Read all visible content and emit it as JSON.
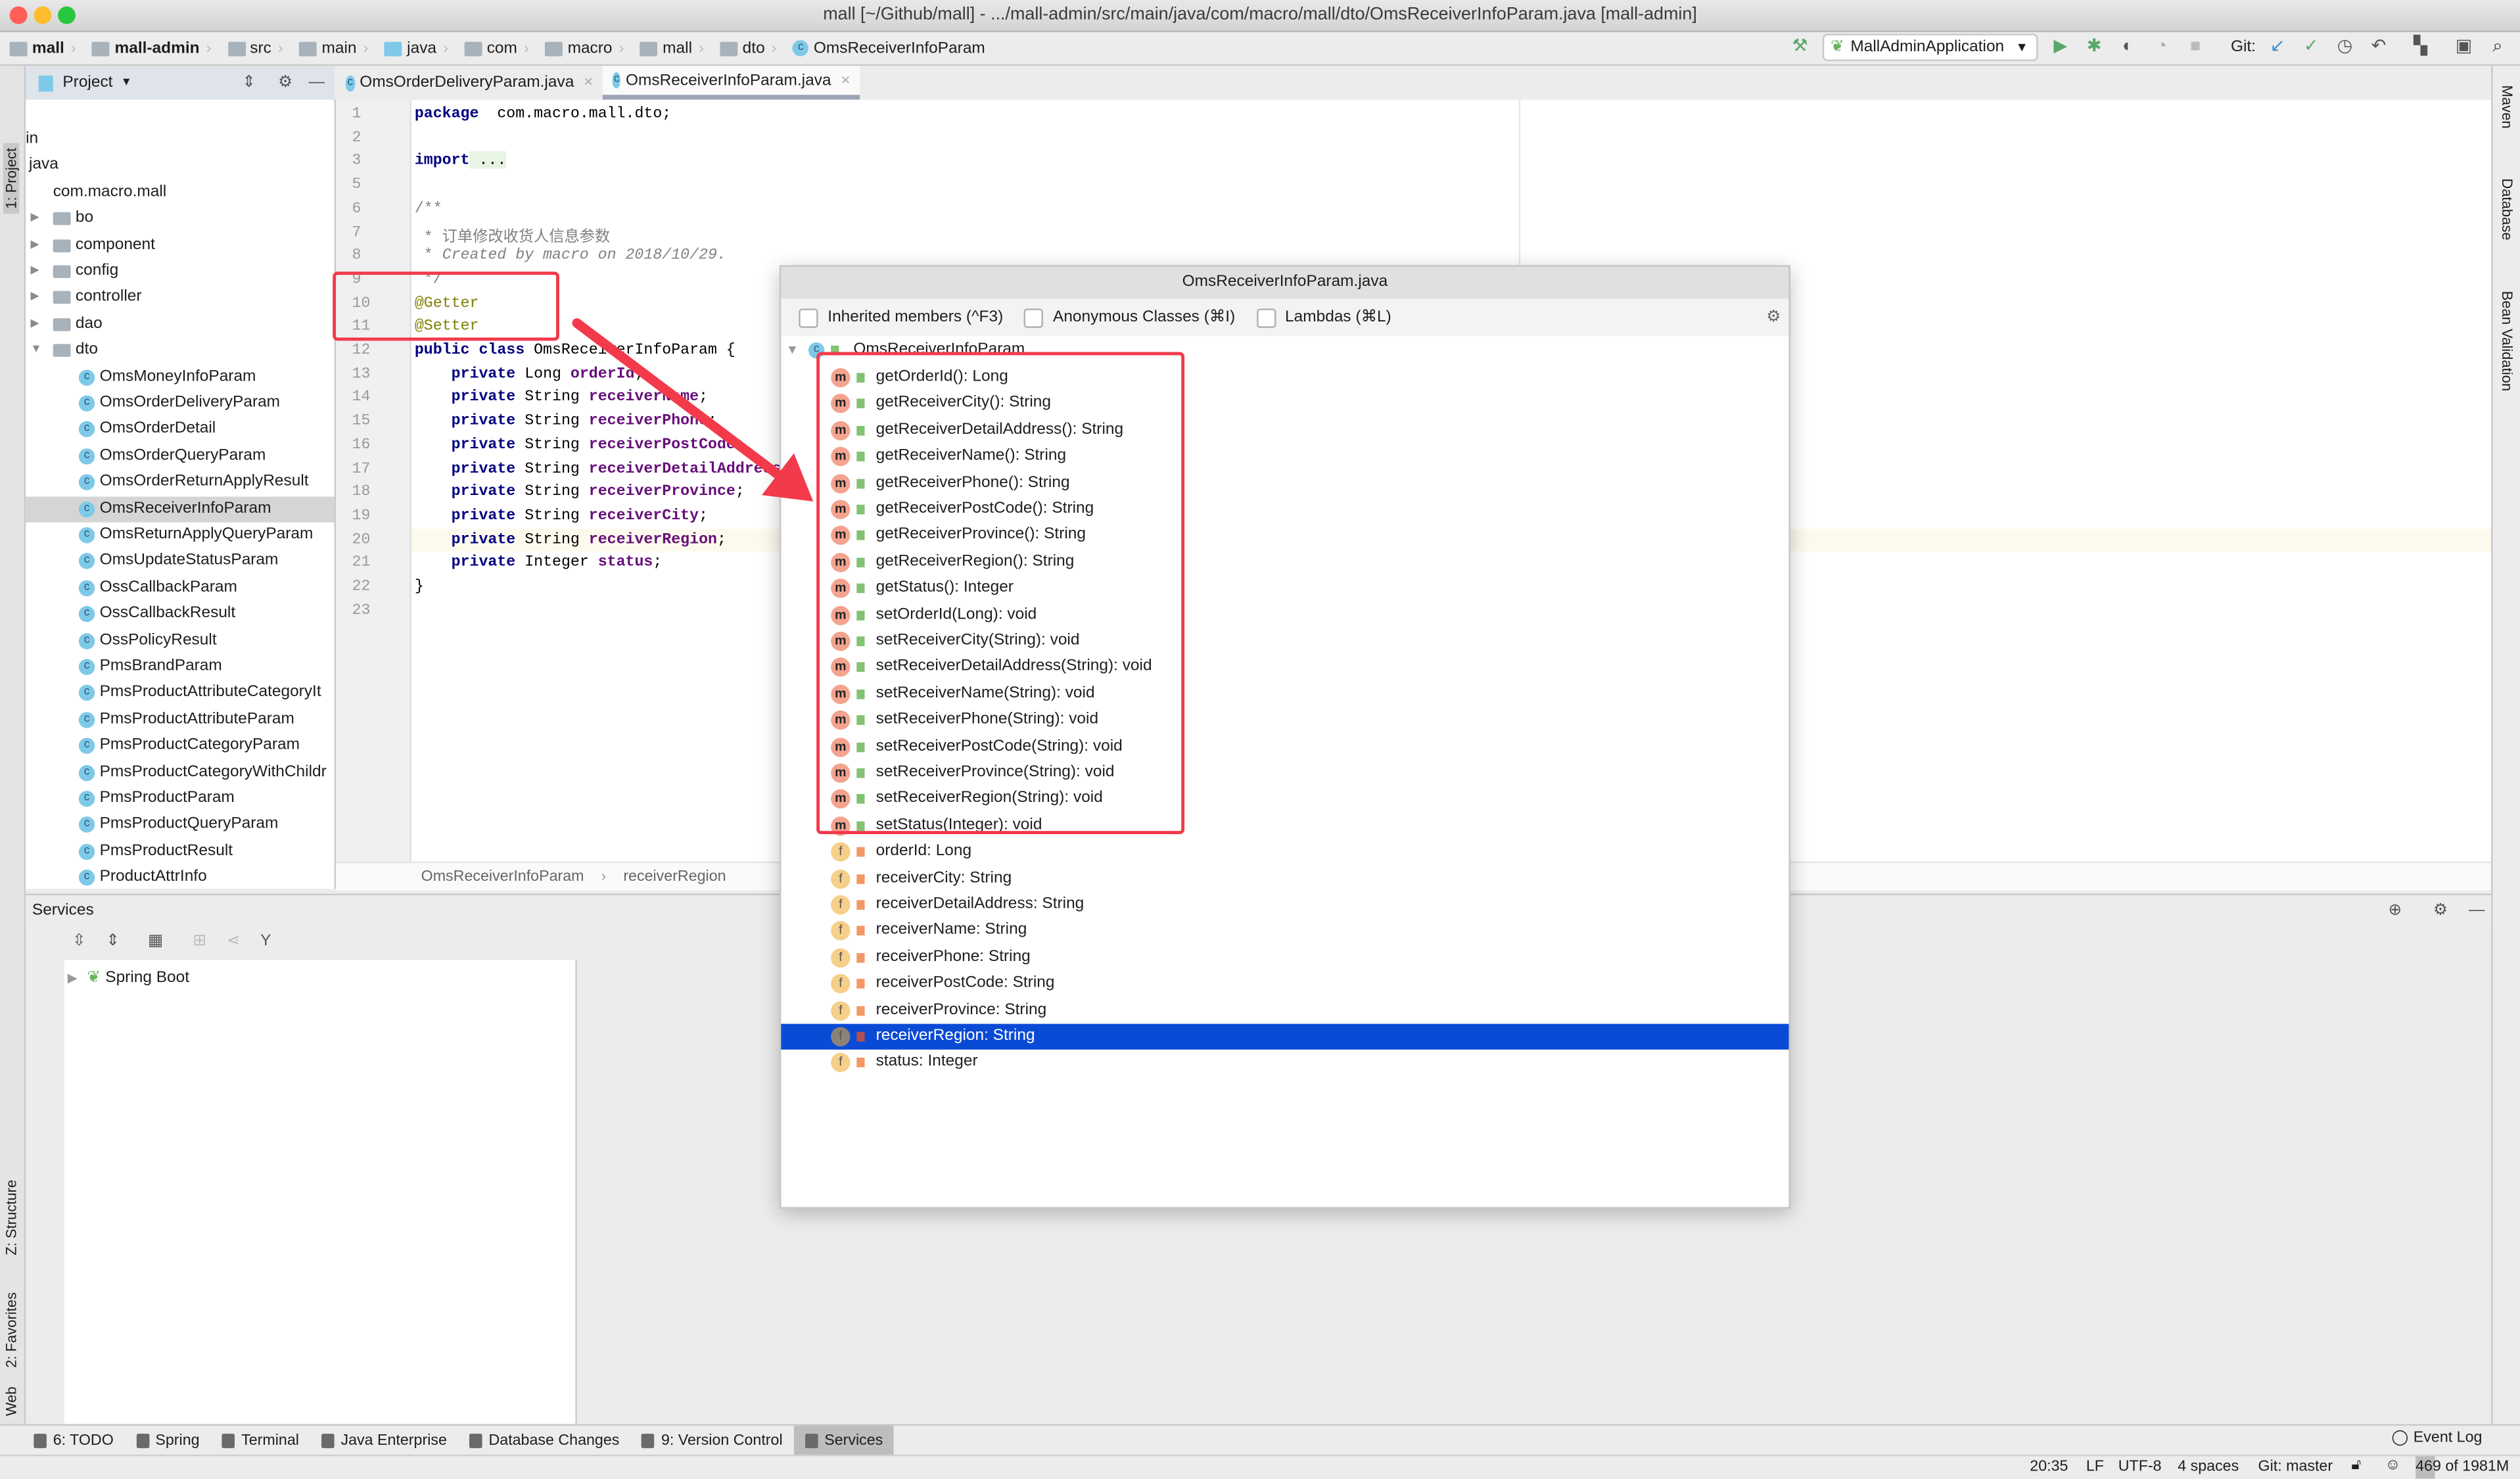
{
  "window": {
    "title": "mall [~/Github/mall] - .../mall-admin/src/main/java/com/macro/mall/dto/OmsReceiverInfoParam.java [mall-admin]"
  },
  "navbar": {
    "crumbs": [
      "mall",
      "mall-admin",
      "src",
      "main",
      "java",
      "com",
      "macro",
      "mall",
      "dto",
      "OmsReceiverInfoParam"
    ],
    "run_config": "MallAdminApplication",
    "git_label": "Git:"
  },
  "left_strip": {
    "project": "1: Project",
    "structure": "Z: Structure",
    "favorites": "2: Favorites",
    "web": "Web"
  },
  "right_strip": {
    "maven": "Maven",
    "database": "Database",
    "bean_validation": "Bean Validation"
  },
  "project_panel": {
    "title": "Project",
    "tree": [
      {
        "label": "in",
        "level": 0
      },
      {
        "label": "java",
        "level": 0
      },
      {
        "label": "com.macro.mall",
        "level": 1
      },
      {
        "label": "bo",
        "level": 2,
        "folder": true
      },
      {
        "label": "component",
        "level": 2,
        "folder": true
      },
      {
        "label": "config",
        "level": 2,
        "folder": true
      },
      {
        "label": "controller",
        "level": 2,
        "folder": true
      },
      {
        "label": "dao",
        "level": 2,
        "folder": true
      },
      {
        "label": "dto",
        "level": 2,
        "folder": true,
        "open": true
      },
      {
        "label": "OmsMoneyInfoParam",
        "level": 3
      },
      {
        "label": "OmsOrderDeliveryParam",
        "level": 3
      },
      {
        "label": "OmsOrderDetail",
        "level": 3
      },
      {
        "label": "OmsOrderQueryParam",
        "level": 3
      },
      {
        "label": "OmsOrderReturnApplyResult",
        "level": 3
      },
      {
        "label": "OmsReceiverInfoParam",
        "level": 3,
        "selected": true
      },
      {
        "label": "OmsReturnApplyQueryParam",
        "level": 3
      },
      {
        "label": "OmsUpdateStatusParam",
        "level": 3
      },
      {
        "label": "OssCallbackParam",
        "level": 3
      },
      {
        "label": "OssCallbackResult",
        "level": 3
      },
      {
        "label": "OssPolicyResult",
        "level": 3
      },
      {
        "label": "PmsBrandParam",
        "level": 3
      },
      {
        "label": "PmsProductAttributeCategoryIt",
        "level": 3
      },
      {
        "label": "PmsProductAttributeParam",
        "level": 3
      },
      {
        "label": "PmsProductCategoryParam",
        "level": 3
      },
      {
        "label": "PmsProductCategoryWithChildr",
        "level": 3
      },
      {
        "label": "PmsProductParam",
        "level": 3
      },
      {
        "label": "PmsProductQueryParam",
        "level": 3
      },
      {
        "label": "PmsProductResult",
        "level": 3
      },
      {
        "label": "ProductAttrInfo",
        "level": 3
      }
    ]
  },
  "editor": {
    "tabs": [
      {
        "label": "OmsOrderDeliveryParam.java",
        "active": false
      },
      {
        "label": "OmsReceiverInfoParam.java",
        "active": true
      }
    ],
    "current_line": "20",
    "lines": [
      {
        "n": "1",
        "html": [
          [
            "kw",
            "package"
          ],
          [
            "",
            "  com.macro.mall.dto;"
          ]
        ]
      },
      {
        "n": "2",
        "html": []
      },
      {
        "n": "3",
        "html": [
          [
            "kw",
            "import"
          ],
          [
            "",
            " ..."
          ]
        ]
      },
      {
        "n": "5",
        "html": []
      },
      {
        "n": "6",
        "html": [
          [
            "cmt",
            "/**"
          ]
        ]
      },
      {
        "n": "7",
        "html": [
          [
            "cmt",
            " * 订单修改收货人信息参数"
          ]
        ]
      },
      {
        "n": "8",
        "html": [
          [
            "cmt",
            " * "
          ],
          [
            "cmti",
            "Created by macro on 2018/10/29."
          ]
        ]
      },
      {
        "n": "9",
        "html": [
          [
            "cmt",
            " */"
          ]
        ]
      },
      {
        "n": "10",
        "html": [
          [
            "ann",
            "@Getter"
          ]
        ]
      },
      {
        "n": "11",
        "html": [
          [
            "ann",
            "@Setter"
          ]
        ]
      },
      {
        "n": "12",
        "html": [
          [
            "kw",
            "public class"
          ],
          [
            "",
            " OmsReceiverInfoParam {"
          ]
        ]
      },
      {
        "n": "13",
        "html": [
          [
            "",
            "    "
          ],
          [
            "kw",
            "private"
          ],
          [
            "",
            " Long "
          ],
          [
            "fld",
            "orderId"
          ],
          [
            "",
            ";"
          ]
        ]
      },
      {
        "n": "14",
        "html": [
          [
            "",
            "    "
          ],
          [
            "kw",
            "private"
          ],
          [
            "",
            " String "
          ],
          [
            "fld",
            "receiverName"
          ],
          [
            "",
            ";"
          ]
        ]
      },
      {
        "n": "15",
        "html": [
          [
            "",
            "    "
          ],
          [
            "kw",
            "private"
          ],
          [
            "",
            " String "
          ],
          [
            "fld",
            "receiverPhone"
          ],
          [
            "",
            ";"
          ]
        ]
      },
      {
        "n": "16",
        "html": [
          [
            "",
            "    "
          ],
          [
            "kw",
            "private"
          ],
          [
            "",
            " String "
          ],
          [
            "fld",
            "receiverPostCode"
          ],
          [
            "",
            ";"
          ]
        ]
      },
      {
        "n": "17",
        "html": [
          [
            "",
            "    "
          ],
          [
            "kw",
            "private"
          ],
          [
            "",
            " String "
          ],
          [
            "fld",
            "receiverDetailAddress"
          ],
          [
            "",
            ";"
          ]
        ]
      },
      {
        "n": "18",
        "html": [
          [
            "",
            "    "
          ],
          [
            "kw",
            "private"
          ],
          [
            "",
            " String "
          ],
          [
            "fld",
            "receiverProvince"
          ],
          [
            "",
            ";"
          ]
        ]
      },
      {
        "n": "19",
        "html": [
          [
            "",
            "    "
          ],
          [
            "kw",
            "private"
          ],
          [
            "",
            " String "
          ],
          [
            "fld",
            "receiverCity"
          ],
          [
            "",
            ";"
          ]
        ]
      },
      {
        "n": "20",
        "html": [
          [
            "",
            "    "
          ],
          [
            "kw",
            "private"
          ],
          [
            "",
            " String "
          ],
          [
            "fld",
            "receiverRegion"
          ],
          [
            "",
            ";"
          ]
        ]
      },
      {
        "n": "21",
        "html": [
          [
            "",
            "    "
          ],
          [
            "kw",
            "private"
          ],
          [
            "",
            " Integer "
          ],
          [
            "fld",
            "status"
          ],
          [
            "",
            ";"
          ]
        ]
      },
      {
        "n": "22",
        "html": [
          [
            "",
            "}"
          ]
        ]
      },
      {
        "n": "23",
        "html": []
      }
    ],
    "breadcrumb": [
      "OmsReceiverInfoParam",
      "receiverRegion"
    ]
  },
  "structure_popup": {
    "title": "OmsReceiverInfoParam.java",
    "options": [
      "Inherited members (^F3)",
      "Anonymous Classes (⌘I)",
      "Lambdas (⌘L)"
    ],
    "root": "OmsReceiverInfoParam",
    "methods": [
      "getOrderId(): Long",
      "getReceiverCity(): String",
      "getReceiverDetailAddress(): String",
      "getReceiverName(): String",
      "getReceiverPhone(): String",
      "getReceiverPostCode(): String",
      "getReceiverProvince(): String",
      "getReceiverRegion(): String",
      "getStatus(): Integer",
      "setOrderId(Long): void",
      "setReceiverCity(String): void",
      "setReceiverDetailAddress(String): void",
      "setReceiverName(String): void",
      "setReceiverPhone(String): void",
      "setReceiverPostCode(String): void",
      "setReceiverProvince(String): void",
      "setReceiverRegion(String): void",
      "setStatus(Integer): void"
    ],
    "fields": [
      "orderId: Long",
      "receiverCity: String",
      "receiverDetailAddress: String",
      "receiverName: String",
      "receiverPhone: String",
      "receiverPostCode: String",
      "receiverProvince: String",
      "receiverRegion: String",
      "status: Integer"
    ],
    "selected_field": "receiverRegion: String"
  },
  "services": {
    "title": "Services",
    "tree": [
      "Spring Boot"
    ]
  },
  "bottom_tools": [
    {
      "label": "6: TODO"
    },
    {
      "label": "Spring"
    },
    {
      "label": "Terminal"
    },
    {
      "label": "Java Enterprise"
    },
    {
      "label": "Database Changes"
    },
    {
      "label": "9: Version Control"
    },
    {
      "label": "Services",
      "active": true
    }
  ],
  "event_log": "Event Log",
  "status": {
    "position": "20:35",
    "line_sep": "LF",
    "encoding": "UTF-8",
    "indent": "4 spaces",
    "git": "Git: master",
    "memory": "469 of 1981M"
  },
  "colors": {
    "annotation_red": "#f23a4b",
    "selection": "#0a4bd6",
    "keyword": "#000080",
    "field": "#660e7a",
    "annotation": "#808000"
  }
}
